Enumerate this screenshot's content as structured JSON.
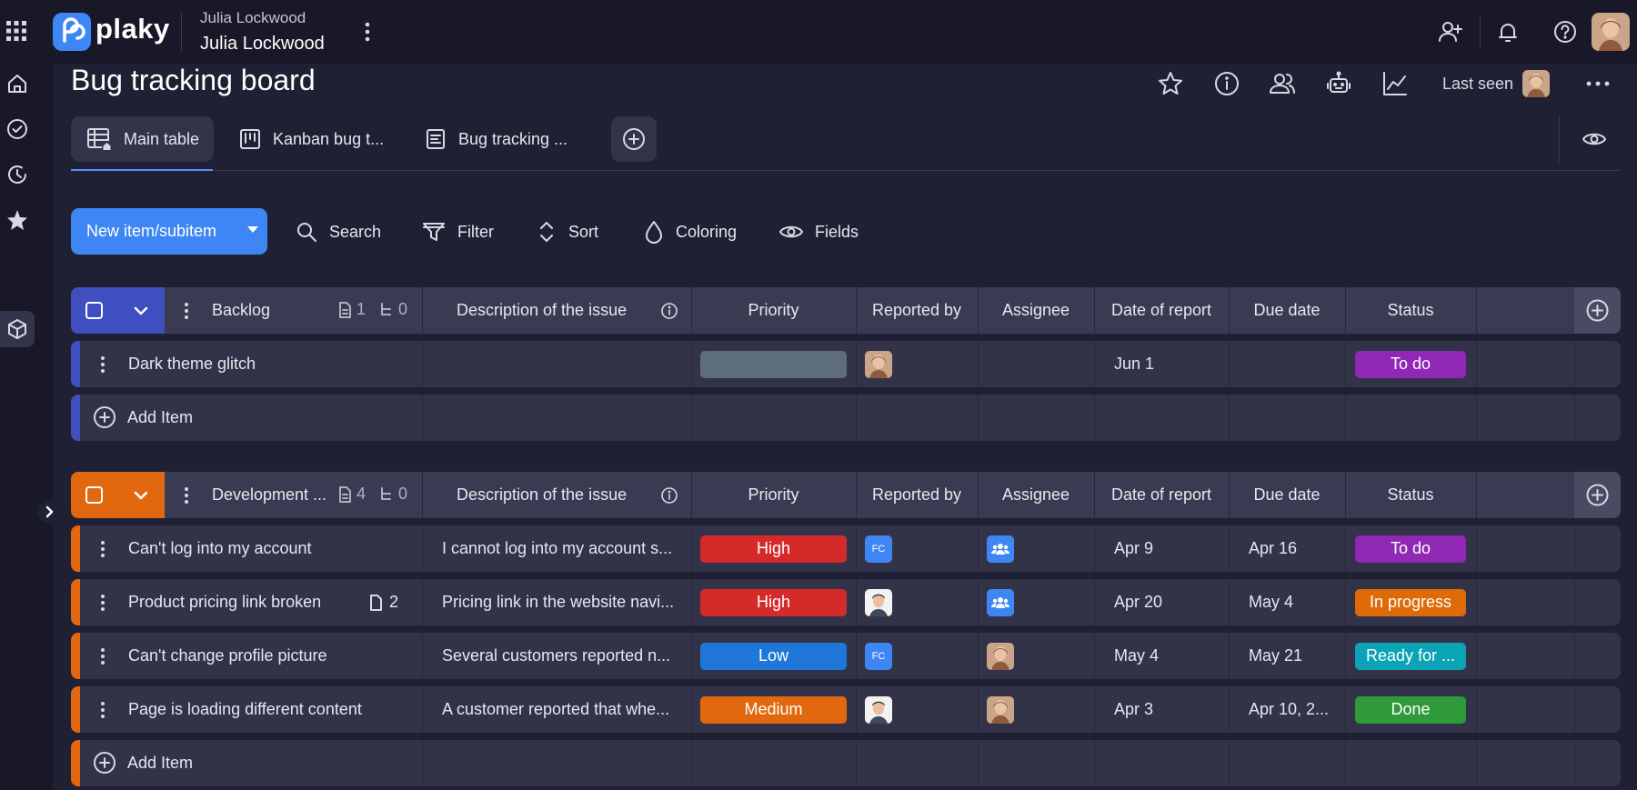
{
  "app": {
    "logo_text": "plaky",
    "workspace_small": "Julia Lockwood",
    "workspace_name": "Julia Lockwood"
  },
  "board": {
    "title": "Bug tracking board",
    "last_seen_label": "Last seen"
  },
  "views": [
    {
      "label": "Main table"
    },
    {
      "label": "Kanban bug t..."
    },
    {
      "label": "Bug tracking ..."
    }
  ],
  "toolbar": {
    "new_label": "New item/subitem",
    "search_label": "Search",
    "filter_label": "Filter",
    "sort_label": "Sort",
    "coloring_label": "Coloring",
    "fields_label": "Fields"
  },
  "columns": {
    "description": "Description of the issue",
    "priority": "Priority",
    "reported_by": "Reported by",
    "assignee": "Assignee",
    "date_of_report": "Date of report",
    "due_date": "Due date",
    "status": "Status"
  },
  "add_item_label": "Add Item",
  "groups": [
    {
      "name": "Backlog",
      "color": "#3f4fc0",
      "items_count": "1",
      "subitems_count": "0",
      "items": [
        {
          "name": "Dark theme glitch",
          "description": "",
          "priority": "",
          "priority_color": "#5d6e7a",
          "reported_by": "avatar-woman",
          "assignee": "",
          "date_of_report": "Jun 1",
          "due_date": "",
          "status": "To do",
          "status_color": "#9027b5"
        }
      ]
    },
    {
      "name": "Development ...",
      "color": "#e2680f",
      "items_count": "4",
      "subitems_count": "0",
      "items": [
        {
          "name": "Can't log into my account",
          "files": "",
          "description": "I cannot log into my account s...",
          "priority": "High",
          "priority_color": "#d42a2a",
          "reported_by": "FC",
          "assignee": "team",
          "date_of_report": "Apr 9",
          "due_date": "Apr 16",
          "status": "To do",
          "status_color": "#9027b5"
        },
        {
          "name": "Product pricing link broken",
          "files": "2",
          "description": "Pricing link in the website navi...",
          "priority": "High",
          "priority_color": "#d42a2a",
          "reported_by": "avatar-man",
          "assignee": "team",
          "date_of_report": "Apr 20",
          "due_date": "May 4",
          "status": "In progress",
          "status_color": "#de6a08"
        },
        {
          "name": "Can't change profile picture",
          "files": "",
          "description": "Several customers reported n...",
          "priority": "Low",
          "priority_color": "#1f78d8",
          "reported_by": "FC",
          "assignee": "avatar-woman",
          "date_of_report": "May 4",
          "due_date": "May 21",
          "status": "Ready for ...",
          "status_color": "#0ba3b5"
        },
        {
          "name": "Page is loading different content",
          "files": "",
          "description": "A customer reported that whe...",
          "priority": "Medium",
          "priority_color": "#e2680f",
          "reported_by": "avatar-man",
          "assignee": "avatar-woman",
          "date_of_report": "Apr 3",
          "due_date": "Apr 10, 2...",
          "status": "Done",
          "status_color": "#2f9a3a"
        }
      ]
    }
  ]
}
